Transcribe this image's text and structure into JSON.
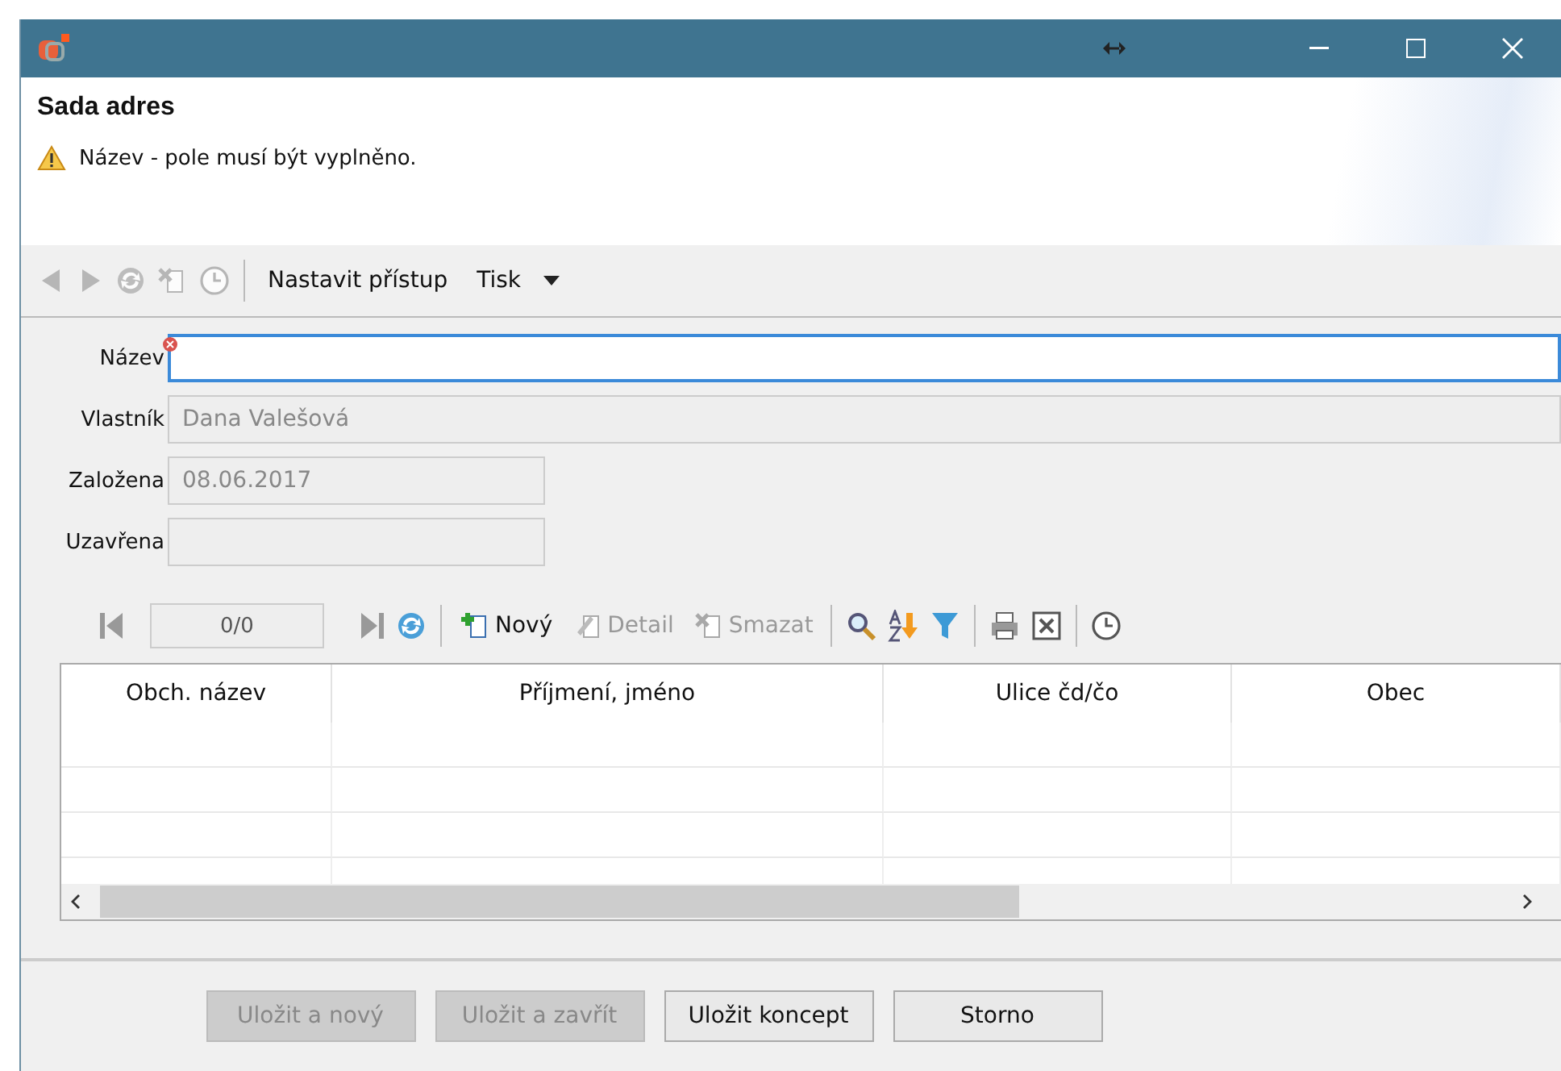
{
  "header": {
    "title": "Sada adres",
    "warning": "Název - pole musí být vyplněno."
  },
  "toolbar": {
    "items": [
      {
        "kind": "icon",
        "disabled": true
      },
      {
        "kind": "icon",
        "disabled": true
      },
      {
        "kind": "icon",
        "disabled": true
      },
      {
        "kind": "icon",
        "disabled": true
      },
      {
        "kind": "icon",
        "disabled": true
      },
      {
        "kind": "separator"
      },
      {
        "kind": "text",
        "label": "Nastavit přístup"
      },
      {
        "kind": "menu",
        "label": "Tisk"
      }
    ]
  },
  "form": {
    "fields": [
      {
        "label": "Název",
        "required": true,
        "focused": true
      },
      {
        "label": "Vlastník",
        "value": "Dana Valešová",
        "required": false,
        "focused": false
      },
      {
        "label": "Založena",
        "value": "08.06.2017",
        "required": false,
        "focused": false
      },
      {
        "label": "Uzavřena",
        "required": false,
        "focused": false
      }
    ]
  },
  "grid_toolbar": {
    "position": "0/0",
    "items": [
      {
        "kind": "icon",
        "disabled": false
      },
      {
        "kind": "separator"
      },
      {
        "kind": "button",
        "label": "Nový",
        "disabled": false
      },
      {
        "kind": "button",
        "label": "Detail",
        "disabled": true
      },
      {
        "kind": "button",
        "label": "Smazat",
        "disabled": true
      },
      {
        "kind": "separator"
      },
      {
        "kind": "icon",
        "disabled": false
      },
      {
        "kind": "icon",
        "disabled": false
      },
      {
        "kind": "icon",
        "disabled": false
      },
      {
        "kind": "separator"
      },
      {
        "kind": "icon",
        "disabled": false
      },
      {
        "kind": "icon",
        "disabled": false
      },
      {
        "kind": "separator"
      },
      {
        "kind": "icon",
        "disabled": false
      }
    ]
  },
  "table": {
    "columns": [
      "Obch. název",
      "Příjmení, jméno",
      "Ulice čd/čo",
      "Obec"
    ]
  },
  "buttons": [
    {
      "label": "Uložit a nový",
      "disabled": true
    },
    {
      "label": "Uložit a zavřít",
      "disabled": true
    },
    {
      "label": "Uložit koncept",
      "disabled": false
    },
    {
      "label": "Storno",
      "disabled": false
    }
  ]
}
